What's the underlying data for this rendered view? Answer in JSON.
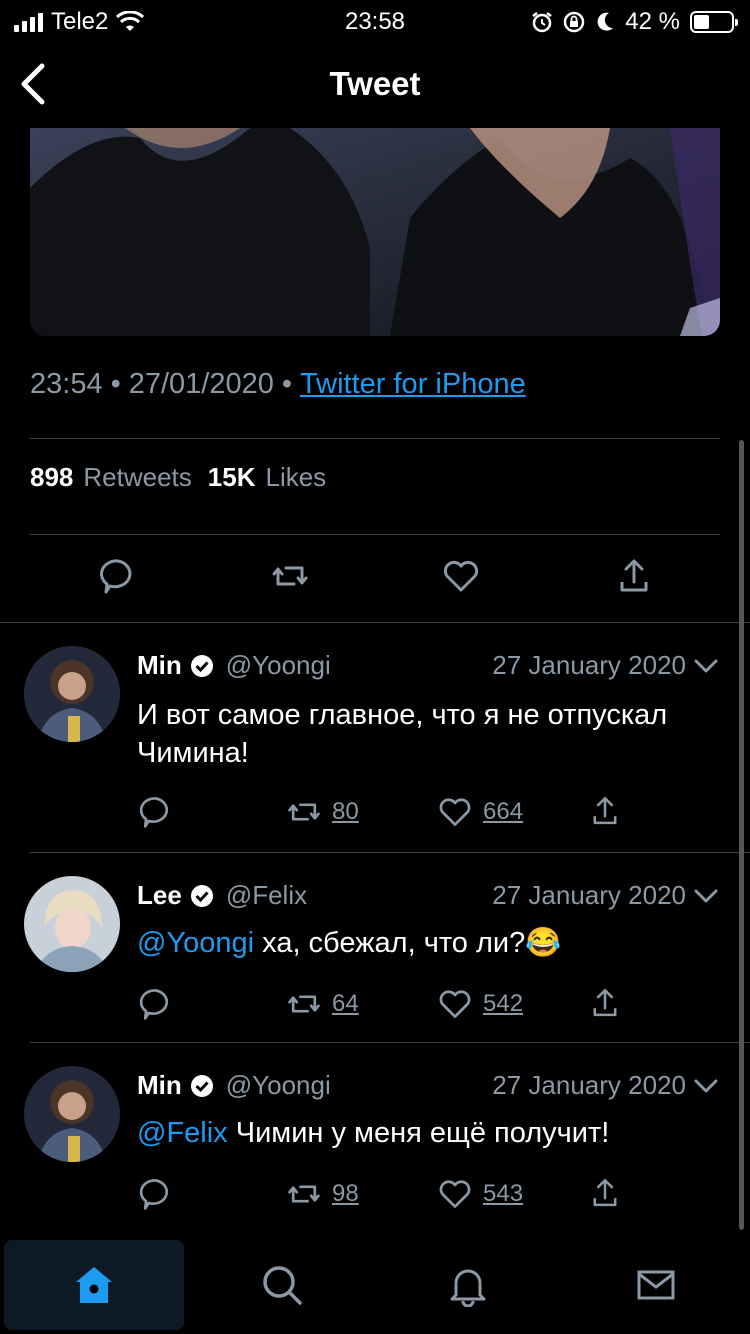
{
  "status_bar": {
    "carrier": "Tele2",
    "time": "23:58",
    "battery": "42 %",
    "battery_level": 0.42
  },
  "header": {
    "title": "Tweet"
  },
  "tweet": {
    "time": "23:54",
    "date": "27/01/2020",
    "source": "Twitter for iPhone",
    "retweets_count": "898",
    "retweets_label": "Retweets",
    "likes_count": "15K",
    "likes_label": "Likes"
  },
  "replies": [
    {
      "name": "Min",
      "handle": "@Yoongi",
      "date": "27 January 2020",
      "mention": "",
      "text": "И вот самое главное, что я не отпускал Чимина!",
      "retweets": "80",
      "likes": "664"
    },
    {
      "name": "Lee",
      "handle": "@Felix",
      "date": "27 January 2020",
      "mention": "@Yoongi",
      "text": "ха, сбежал, что ли?😂",
      "retweets": "64",
      "likes": "542"
    },
    {
      "name": "Min",
      "handle": "@Yoongi",
      "date": "27 January 2020",
      "mention": "@Felix",
      "text": "Чимин у меня ещё получит!",
      "retweets": "98",
      "likes": "543"
    }
  ],
  "colors": {
    "accent": "#1d9bf0",
    "muted": "#8b98a5",
    "divider": "#38444d",
    "background": "#000000"
  },
  "tabbar": {
    "items": [
      "home-icon",
      "search-icon",
      "bell-icon",
      "mail-icon"
    ],
    "active": "home-icon"
  }
}
